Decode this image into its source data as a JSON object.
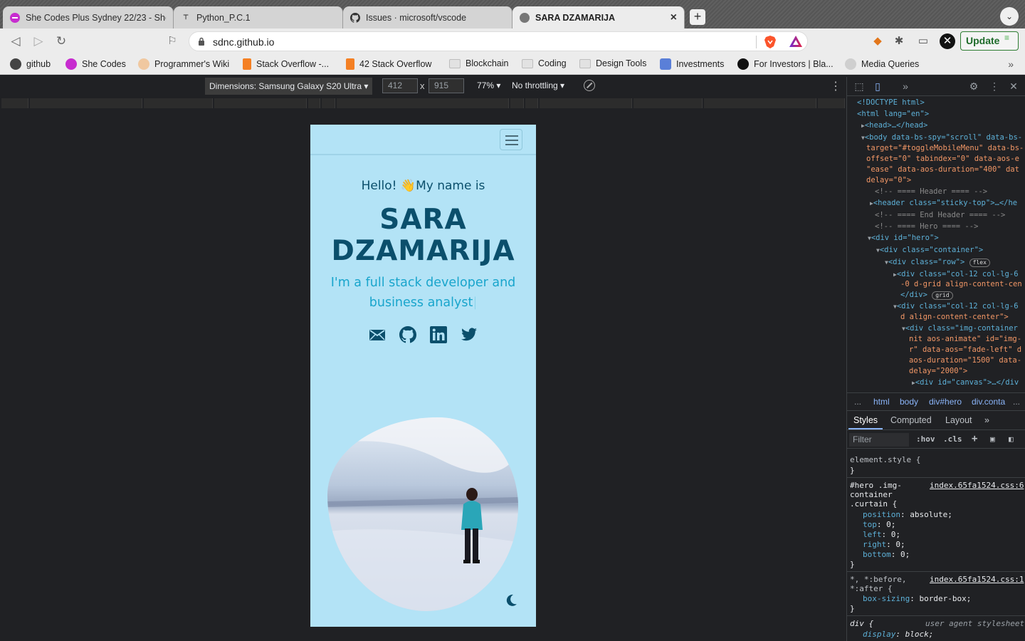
{
  "browser": {
    "tabs": [
      {
        "title": "She Codes Plus Sydney 22/23 - She",
        "favicon": "shecodes-icon",
        "color": "#c72ccf"
      },
      {
        "title": "Python_P.C.1",
        "favicon": "python-icon",
        "color": "#333333"
      },
      {
        "title": "Issues · microsoft/vscode",
        "favicon": "github-icon",
        "color": "#333333"
      },
      {
        "title": "SARA DZAMARIJA",
        "favicon": "globe-icon",
        "color": "#666666",
        "close": "×"
      }
    ],
    "new_tab": "+",
    "url": "sdnc.github.io",
    "update_label": "Update"
  },
  "bookmarks": [
    {
      "label": "github",
      "icon": "github-icon"
    },
    {
      "label": "She Codes",
      "icon": "shecodes-icon"
    },
    {
      "label": "Programmer's Wiki",
      "icon": "avatar-icon"
    },
    {
      "label": "Stack Overflow -...",
      "icon": "stackoverflow-icon"
    },
    {
      "label": "42 Stack Overflow",
      "icon": "stackoverflow-icon"
    },
    {
      "label": "Blockchain",
      "icon": "folder-icon"
    },
    {
      "label": "Coding",
      "icon": "folder-icon"
    },
    {
      "label": "Design Tools",
      "icon": "folder-icon"
    },
    {
      "label": "Investments",
      "icon": "rocket-icon"
    },
    {
      "label": "For Investors | Bla...",
      "icon": "site-icon"
    },
    {
      "label": "Media Queries",
      "icon": "globe-icon"
    }
  ],
  "device_toolbar": {
    "dimensions": "Dimensions: Samsung Galaxy S20 Ultra",
    "width": "412",
    "height": "915",
    "x": "x",
    "zoom": "77%",
    "throttling": "No throttling"
  },
  "page": {
    "hello": "Hello! 👋My name is",
    "name_line1": "SARA",
    "name_line2": "DZAMARIJA",
    "tagline": "I'm a full stack developer and business analyst",
    "cursor": "|",
    "socials": [
      "email-icon",
      "github-icon",
      "linkedin-icon",
      "twitter-icon"
    ],
    "colors": {
      "background": "#b3e3f6",
      "heading": "#0b4f6c",
      "accent": "#19a5cc"
    }
  },
  "devtools": {
    "breadcrumbs": [
      "...",
      "html",
      "body",
      "div#hero",
      "div.conta",
      "..."
    ],
    "subtabs": [
      "Styles",
      "Computed",
      "Layout",
      "»"
    ],
    "filter_placeholder": "Filter",
    "hov": ":hov",
    "cls": ".cls",
    "dom": {
      "doctype": "<!DOCTYPE html>",
      "html_open": "<html lang=\"en\">",
      "head": "<head>…</head>",
      "body_1": "<body data-bs-spy=\"scroll\" data-bs-",
      "body_2": "target=\"#toggleMobileMenu\" data-bs-",
      "body_3": "offset=\"0\" tabindex=\"0\" data-aos-e",
      "body_4": "\"ease\" data-aos-duration=\"400\" dat",
      "body_5": "delay=\"0\">",
      "c_header": "<!-- ==== Header ==== -->",
      "header": "<header class=\"sticky-top\">…</he",
      "c_end_header": "<!-- ==== End Header ==== -->",
      "c_hero": "<!-- ==== Hero ==== -->",
      "hero": "<div id=\"hero\">",
      "container": "<div class=\"container\">",
      "row": "<div class=\"row\">",
      "row_badge": "flex",
      "col1_1": "<div class=\"col-12 col-lg-6",
      "col1_2": "-0 d-grid align-content-cen",
      "col1_3": "</div>",
      "col1_badge": "grid",
      "col2_1": "<div class=\"col-12 col-lg-6",
      "col2_2": "d align-content-center\">",
      "img_1": "<div class=\"img-container",
      "img_2": "nit aos-animate\" id=\"img-",
      "img_3": "r\" data-aos=\"fade-left\" d",
      "img_4": "aos-duration=\"1500\" data-",
      "img_5": "delay=\"2000\">",
      "canvas": "<div id=\"canvas\">…</div"
    },
    "styles": {
      "element_style": "element.style {",
      "close": "}",
      "rule1_sel_1": "#hero .img-",
      "rule1_sel_2": "container",
      "rule1_sel_3": ".curtain {",
      "rule1_src": "index.65fa1524.css:6",
      "rule1_props": [
        {
          "p": "position",
          "v": "absolute;"
        },
        {
          "p": "top",
          "v": "0;"
        },
        {
          "p": "left",
          "v": "0;"
        },
        {
          "p": "right",
          "v": "0;"
        },
        {
          "p": "bottom",
          "v": "0;"
        }
      ],
      "rule2_sel_1": "*, *:before,",
      "rule2_sel_2": "*:after {",
      "rule2_src": "index.65fa1524.css:1",
      "rule2_prop": "box-sizing",
      "rule2_val": "border-box;",
      "rule3_sel": "div {",
      "rule3_src": "user agent stylesheet",
      "rule3_prop": "display",
      "rule3_val": "block;"
    }
  }
}
